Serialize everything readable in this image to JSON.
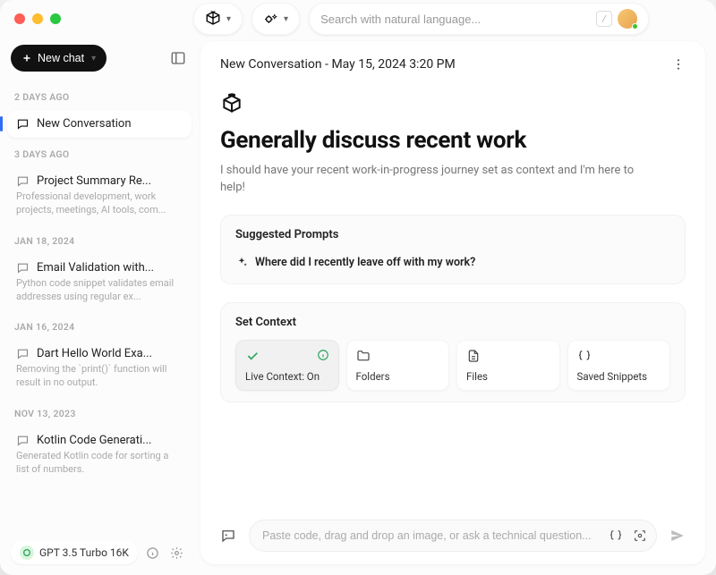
{
  "search": {
    "placeholder": "Search with natural language...",
    "slash": "/"
  },
  "sidebar": {
    "new_chat_label": "New chat",
    "groups": [
      {
        "label": "2 DAYS AGO",
        "items": [
          {
            "title": "New Conversation",
            "desc": "",
            "active": true
          }
        ]
      },
      {
        "label": "3 DAYS AGO",
        "items": [
          {
            "title": "Project Summary Re...",
            "desc": "Professional development, work projects, meetings, AI tools, com..."
          }
        ]
      },
      {
        "label": "JAN 18, 2024",
        "items": [
          {
            "title": "Email Validation with...",
            "desc": "Python code snippet validates email addresses using regular ex..."
          }
        ]
      },
      {
        "label": "JAN 16, 2024",
        "items": [
          {
            "title": "Dart Hello World Exa...",
            "desc": "Removing the `print()` function will result in no output."
          }
        ]
      },
      {
        "label": "NOV 13, 2023",
        "items": [
          {
            "title": "Kotlin Code Generati...",
            "desc": "Generated Kotlin code for sorting a list of numbers."
          }
        ]
      }
    ],
    "model_label": "GPT 3.5 Turbo 16K"
  },
  "main": {
    "header_title": "New Conversation - May 15, 2024 3:20 PM",
    "hero_title": "Generally discuss recent work",
    "hero_sub": "I should have your recent work-in-progress journey set as context and I'm here to help!",
    "suggested_title": "Suggested Prompts",
    "suggested_prompt": "Where did I recently leave off with my work?",
    "context_title": "Set Context",
    "context_chips": [
      {
        "label": "Live Context: On",
        "icon": "check",
        "active": true,
        "right": "info"
      },
      {
        "label": "Folders",
        "icon": "folder"
      },
      {
        "label": "Files",
        "icon": "file"
      },
      {
        "label": "Saved Snippets",
        "icon": "braces"
      }
    ],
    "composer_placeholder": "Paste code, drag and drop an image, or ask a technical question..."
  }
}
